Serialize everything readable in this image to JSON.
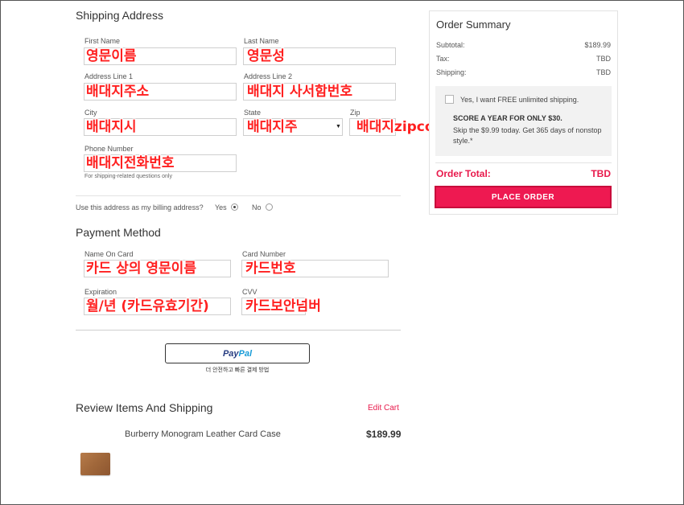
{
  "shipping": {
    "title": "Shipping Address",
    "first_name_label": "First Name",
    "last_name_label": "Last Name",
    "address1_label": "Address Line 1",
    "address2_label": "Address Line 2",
    "city_label": "City",
    "state_label": "State",
    "zip_label": "Zip",
    "phone_label": "Phone Number",
    "phone_hint": "For shipping-related questions only",
    "billing_question": "Use this address as my billing address?",
    "yes_label": "Yes",
    "no_label": "No",
    "billing_selected": "Yes"
  },
  "shipping_notes": {
    "first_name": "영문이름",
    "last_name": "영문성",
    "address1": "배대지주소",
    "address2": "배대지 사서함번호",
    "city": "배대지시",
    "state": "배대지주",
    "zip": "배대지zipcode",
    "phone": "배대지전화번호"
  },
  "payment": {
    "title": "Payment Method",
    "name_label": "Name On Card",
    "card_label": "Card Number",
    "expiration_label": "Expiration",
    "cvv_label": "CVV",
    "paypal_text_dark": "Pay",
    "paypal_text_light": "Pal",
    "paypal_caption": "더 안전하고 빠른 결제 방법"
  },
  "payment_notes": {
    "name": "카드 상의 영문이름",
    "card": "카드번호",
    "expiration": "월/년 (카드유효기간)",
    "cvv": "카드보안넘버"
  },
  "review": {
    "title": "Review Items And Shipping",
    "edit_cart": "Edit Cart",
    "items": [
      {
        "name": "Burberry Monogram Leather Card Case",
        "price": "$189.99"
      }
    ]
  },
  "summary": {
    "title": "Order Summary",
    "subtotal_label": "Subtotal:",
    "subtotal_value": "$189.99",
    "tax_label": "Tax:",
    "tax_value": "TBD",
    "shipping_label": "Shipping:",
    "shipping_value": "TBD",
    "promo_check_label": "Yes, I want FREE unlimited shipping.",
    "promo_headline": "SCORE A YEAR FOR ONLY $30.",
    "promo_text": "Skip the $9.99 today. Get 365 days of nonstop style.*",
    "total_label": "Order Total:",
    "total_value": "TBD",
    "place_order": "PLACE ORDER"
  },
  "colors": {
    "accent": "#ee1951",
    "annotation": "#ff2020",
    "paypal_dark": "#253b80",
    "paypal_light": "#179bd7"
  }
}
